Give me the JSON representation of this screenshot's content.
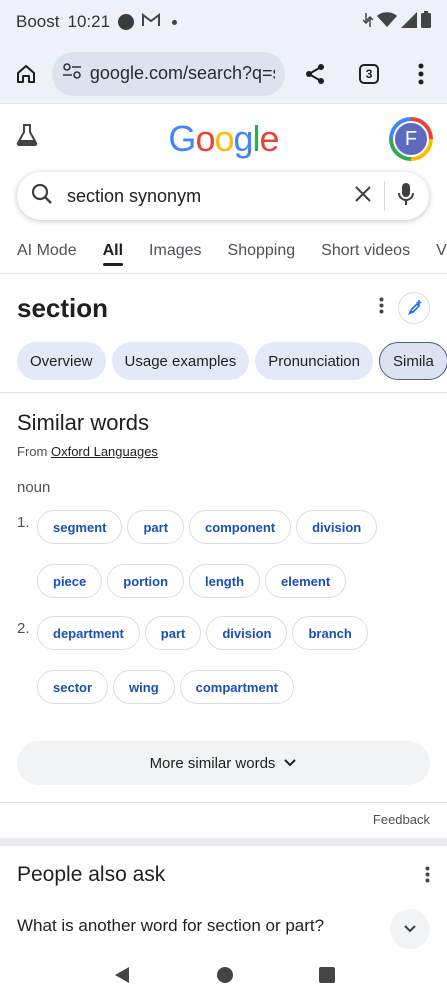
{
  "status": {
    "carrier": "Boost",
    "time": "10:21"
  },
  "browser": {
    "url": "google.com/search?q=section+synonym",
    "tab_count": "3"
  },
  "google": {
    "logo_letters": [
      {
        "ch": "G",
        "color": "#4285f4"
      },
      {
        "ch": "o",
        "color": "#ea4335"
      },
      {
        "ch": "o",
        "color": "#fbbc05"
      },
      {
        "ch": "g",
        "color": "#4285f4"
      },
      {
        "ch": "l",
        "color": "#34a853"
      },
      {
        "ch": "e",
        "color": "#ea4335"
      }
    ],
    "avatar_letter": "F"
  },
  "search": {
    "query": "section synonym"
  },
  "tabs": [
    "AI Mode",
    "All",
    "Images",
    "Shopping",
    "Short videos",
    "Vi"
  ],
  "active_tab": "All",
  "word": {
    "title": "section",
    "chips": [
      "Overview",
      "Usage examples",
      "Pronunciation",
      "Simila"
    ]
  },
  "similar": {
    "title": "Similar words",
    "from_prefix": "From",
    "source": "Oxford Languages",
    "part_of_speech": "noun",
    "senses": [
      {
        "num": "1.",
        "rows": [
          [
            "segment",
            "part",
            "component",
            "division"
          ],
          [
            "piece",
            "portion",
            "length",
            "element"
          ]
        ]
      },
      {
        "num": "2.",
        "rows": [
          [
            "department",
            "part",
            "division",
            "branch"
          ],
          [
            "sector",
            "wing",
            "compartment"
          ]
        ]
      }
    ],
    "more_label": "More similar words"
  },
  "feedback_label": "Feedback",
  "paa": {
    "title": "People also ask",
    "question": "What is another word for section or part?"
  },
  "colors": {
    "accent_blue": "#1a4fb8",
    "chip_bg": "#e3e9f6",
    "toolbar_bg": "#eef1f8"
  }
}
